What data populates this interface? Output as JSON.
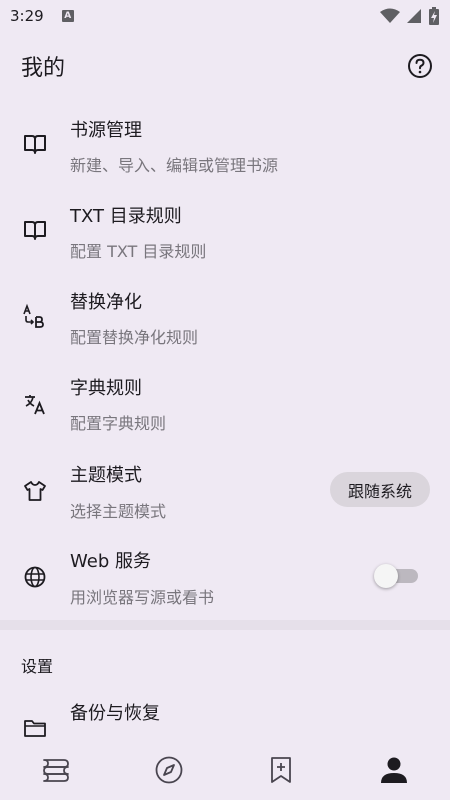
{
  "status_bar": {
    "time": "3:29",
    "notification_badge": "A"
  },
  "header": {
    "title": "我的"
  },
  "menu": [
    {
      "title": "书源管理",
      "subtitle": "新建、导入、编辑或管理书源",
      "icon": "book-open-icon"
    },
    {
      "title": "TXT 目录规则",
      "subtitle": "配置 TXT 目录规则",
      "icon": "book-open-icon"
    },
    {
      "title": "替换净化",
      "subtitle": "配置替换净化规则",
      "icon": "find-replace-icon"
    },
    {
      "title": "字典规则",
      "subtitle": "配置字典规则",
      "icon": "translate-icon"
    },
    {
      "title": "主题模式",
      "subtitle": "选择主题模式",
      "icon": "tshirt-icon",
      "value": "跟随系统"
    },
    {
      "title": "Web 服务",
      "subtitle": "用浏览器写源或看书",
      "icon": "globe-icon",
      "toggle_on": false
    }
  ],
  "settings_section": {
    "header": "设置",
    "items": [
      {
        "title": "备份与恢复",
        "icon": "folder-icon"
      }
    ]
  },
  "bottom_nav": [
    {
      "icon": "bookshelf-icon",
      "selected": false
    },
    {
      "icon": "compass-icon",
      "selected": false
    },
    {
      "icon": "bookmark-add-icon",
      "selected": false
    },
    {
      "icon": "person-icon",
      "selected": true
    }
  ],
  "colors": {
    "background": "#EFE9F3",
    "text": "#1D1B20",
    "subtext": "#79767D",
    "chip": "#DAD5DC"
  }
}
